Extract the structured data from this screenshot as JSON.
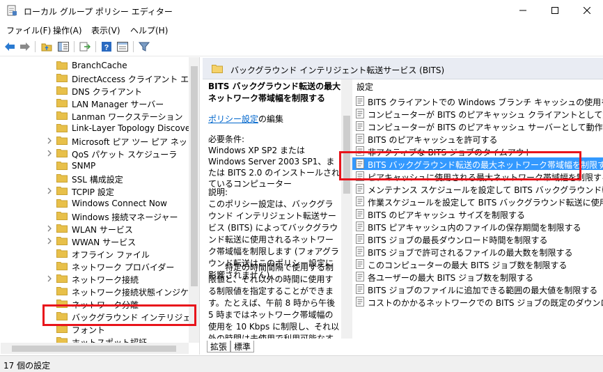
{
  "window": {
    "title": "ローカル グループ ポリシー エディター",
    "minimize_icon": "minimize-icon",
    "maximize_icon": "maximize-icon",
    "close_icon": "close-icon"
  },
  "menu": [
    {
      "label": "ファイル(F)"
    },
    {
      "label": "操作(A)"
    },
    {
      "label": "表示(V)"
    },
    {
      "label": "ヘルプ(H)"
    }
  ],
  "toolbar": {
    "icons": [
      "back-arrow-icon",
      "forward-arrow-icon",
      "up-folder-icon",
      "show-hide-tree-icon",
      "export-list-icon",
      "help-icon",
      "properties-icon",
      "filter-icon"
    ]
  },
  "tree": {
    "items": [
      {
        "label": "BranchCache",
        "expandable": false
      },
      {
        "label": "DirectAccess クライアント エクスペリ",
        "expandable": false
      },
      {
        "label": "DNS クライアント",
        "expandable": false
      },
      {
        "label": "LAN Manager サーバー",
        "expandable": false
      },
      {
        "label": "Lanman ワークステーション",
        "expandable": false
      },
      {
        "label": "Link-Layer Topology Discovery",
        "expandable": false
      },
      {
        "label": "Microsoft ピア ツー ピア ネットワーク",
        "expandable": true
      },
      {
        "label": "QoS パケット スケジューラ",
        "expandable": true
      },
      {
        "label": "SNMP",
        "expandable": false
      },
      {
        "label": "SSL 構成設定",
        "expandable": false
      },
      {
        "label": "TCPIP 設定",
        "expandable": true
      },
      {
        "label": "Windows Connect Now",
        "expandable": false
      },
      {
        "label": "Windows 接続マネージャー",
        "expandable": false
      },
      {
        "label": "WLAN サービス",
        "expandable": true
      },
      {
        "label": "WWAN サービス",
        "expandable": true
      },
      {
        "label": "オフライン ファイル",
        "expandable": false
      },
      {
        "label": "ネットワーク プロバイダー",
        "expandable": false
      },
      {
        "label": "ネットワーク接続",
        "expandable": true
      },
      {
        "label": "ネットワーク接続状態インジケーター",
        "expandable": false
      },
      {
        "label": "ネットワーク分離",
        "expandable": false
      },
      {
        "label": "バックグラウンド インテリジェント転送",
        "expandable": false,
        "selected": true
      },
      {
        "label": "フォント",
        "expandable": false
      },
      {
        "label": "ホットスポット認証",
        "expandable": false
      }
    ]
  },
  "right": {
    "header": "バックグラウンド インテリジェント転送サービス (BITS)",
    "desc": {
      "title": "BITS バックグラウンド転送の最大ネットワーク帯域幅を制限する",
      "link": "ポリシー設定",
      "link_suffix": "の編集",
      "requirements": "必要条件:\nWindows XP SP2 または Windows Server 2003 SP1、または BITS 2.0 のインストールされているコンピューター",
      "explanation": "説明:\nこのポリシー設定は、バックグラウンド インテリジェント転送サービス (BITS) によってバックグラウンド転送に使用されるネットワーク帯域幅を制限します (フォアグラウンド転送はこのポリシー設定に影響されません)。",
      "explanation2": "特定の時間間隔で使用する制限値と、それ以外の時間に使用する制限値を指定することができます。たとえば、午前 8 時から午後 5 時まではネットワーク帯域幅の使用を 10 Kbps に制限し、それ以外の時間は未使用で利用可能なすべての帯域幅を使用するよ"
    },
    "column_header": "設定",
    "settings": [
      "BITS クライアントでの Windows ブランチ キャッシュの使用を許可し...",
      "コンピューターが BITS のピアキャッシュ クライアントとして動作しないよ...",
      "コンピューターが BITS のピアキャッシュ サーバーとして動作しないように...",
      "BITS のピアキャッシュを許可する",
      "非アクティブな BITS ジョブのタイムアウト",
      "BITS バックグラウンド転送の最大ネットワーク帯域幅を制限する",
      "ピアキャッシュに使用される最大ネットワーク帯域幅を制限する",
      "メンテナンス スケジュールを設定して BITS バックグラウンド転送に使用...",
      "作業スケジュールを設定して BITS バックグラウンド転送に使用される...",
      "BITS のピアキャッシュ サイズを制限する",
      "BITS ピアキャッシュ内のファイルの保存期間を制限する",
      "BITS ジョブの最長ダウンロード時間を制限する",
      "BITS ジョブで許可されるファイルの最大数を制限する",
      "このコンピューターの最大 BITS ジョブ数を制限する",
      "各ユーザーの最大 BITS ジョブ数を制限する",
      "BITS ジョブのファイルに追加できる範囲の最大値を制限する",
      "コストのかかるネットワークでの BITS ジョブの既定のダウンロード動作..."
    ],
    "selected_index": 5,
    "tabs": [
      "拡張",
      "標準"
    ]
  },
  "status": "17 個の設定",
  "colors": {
    "highlight_box": "#e8141b",
    "selection": "#3399ff",
    "header_bg": "#e9ecf3",
    "folder": "#e8c04a"
  }
}
